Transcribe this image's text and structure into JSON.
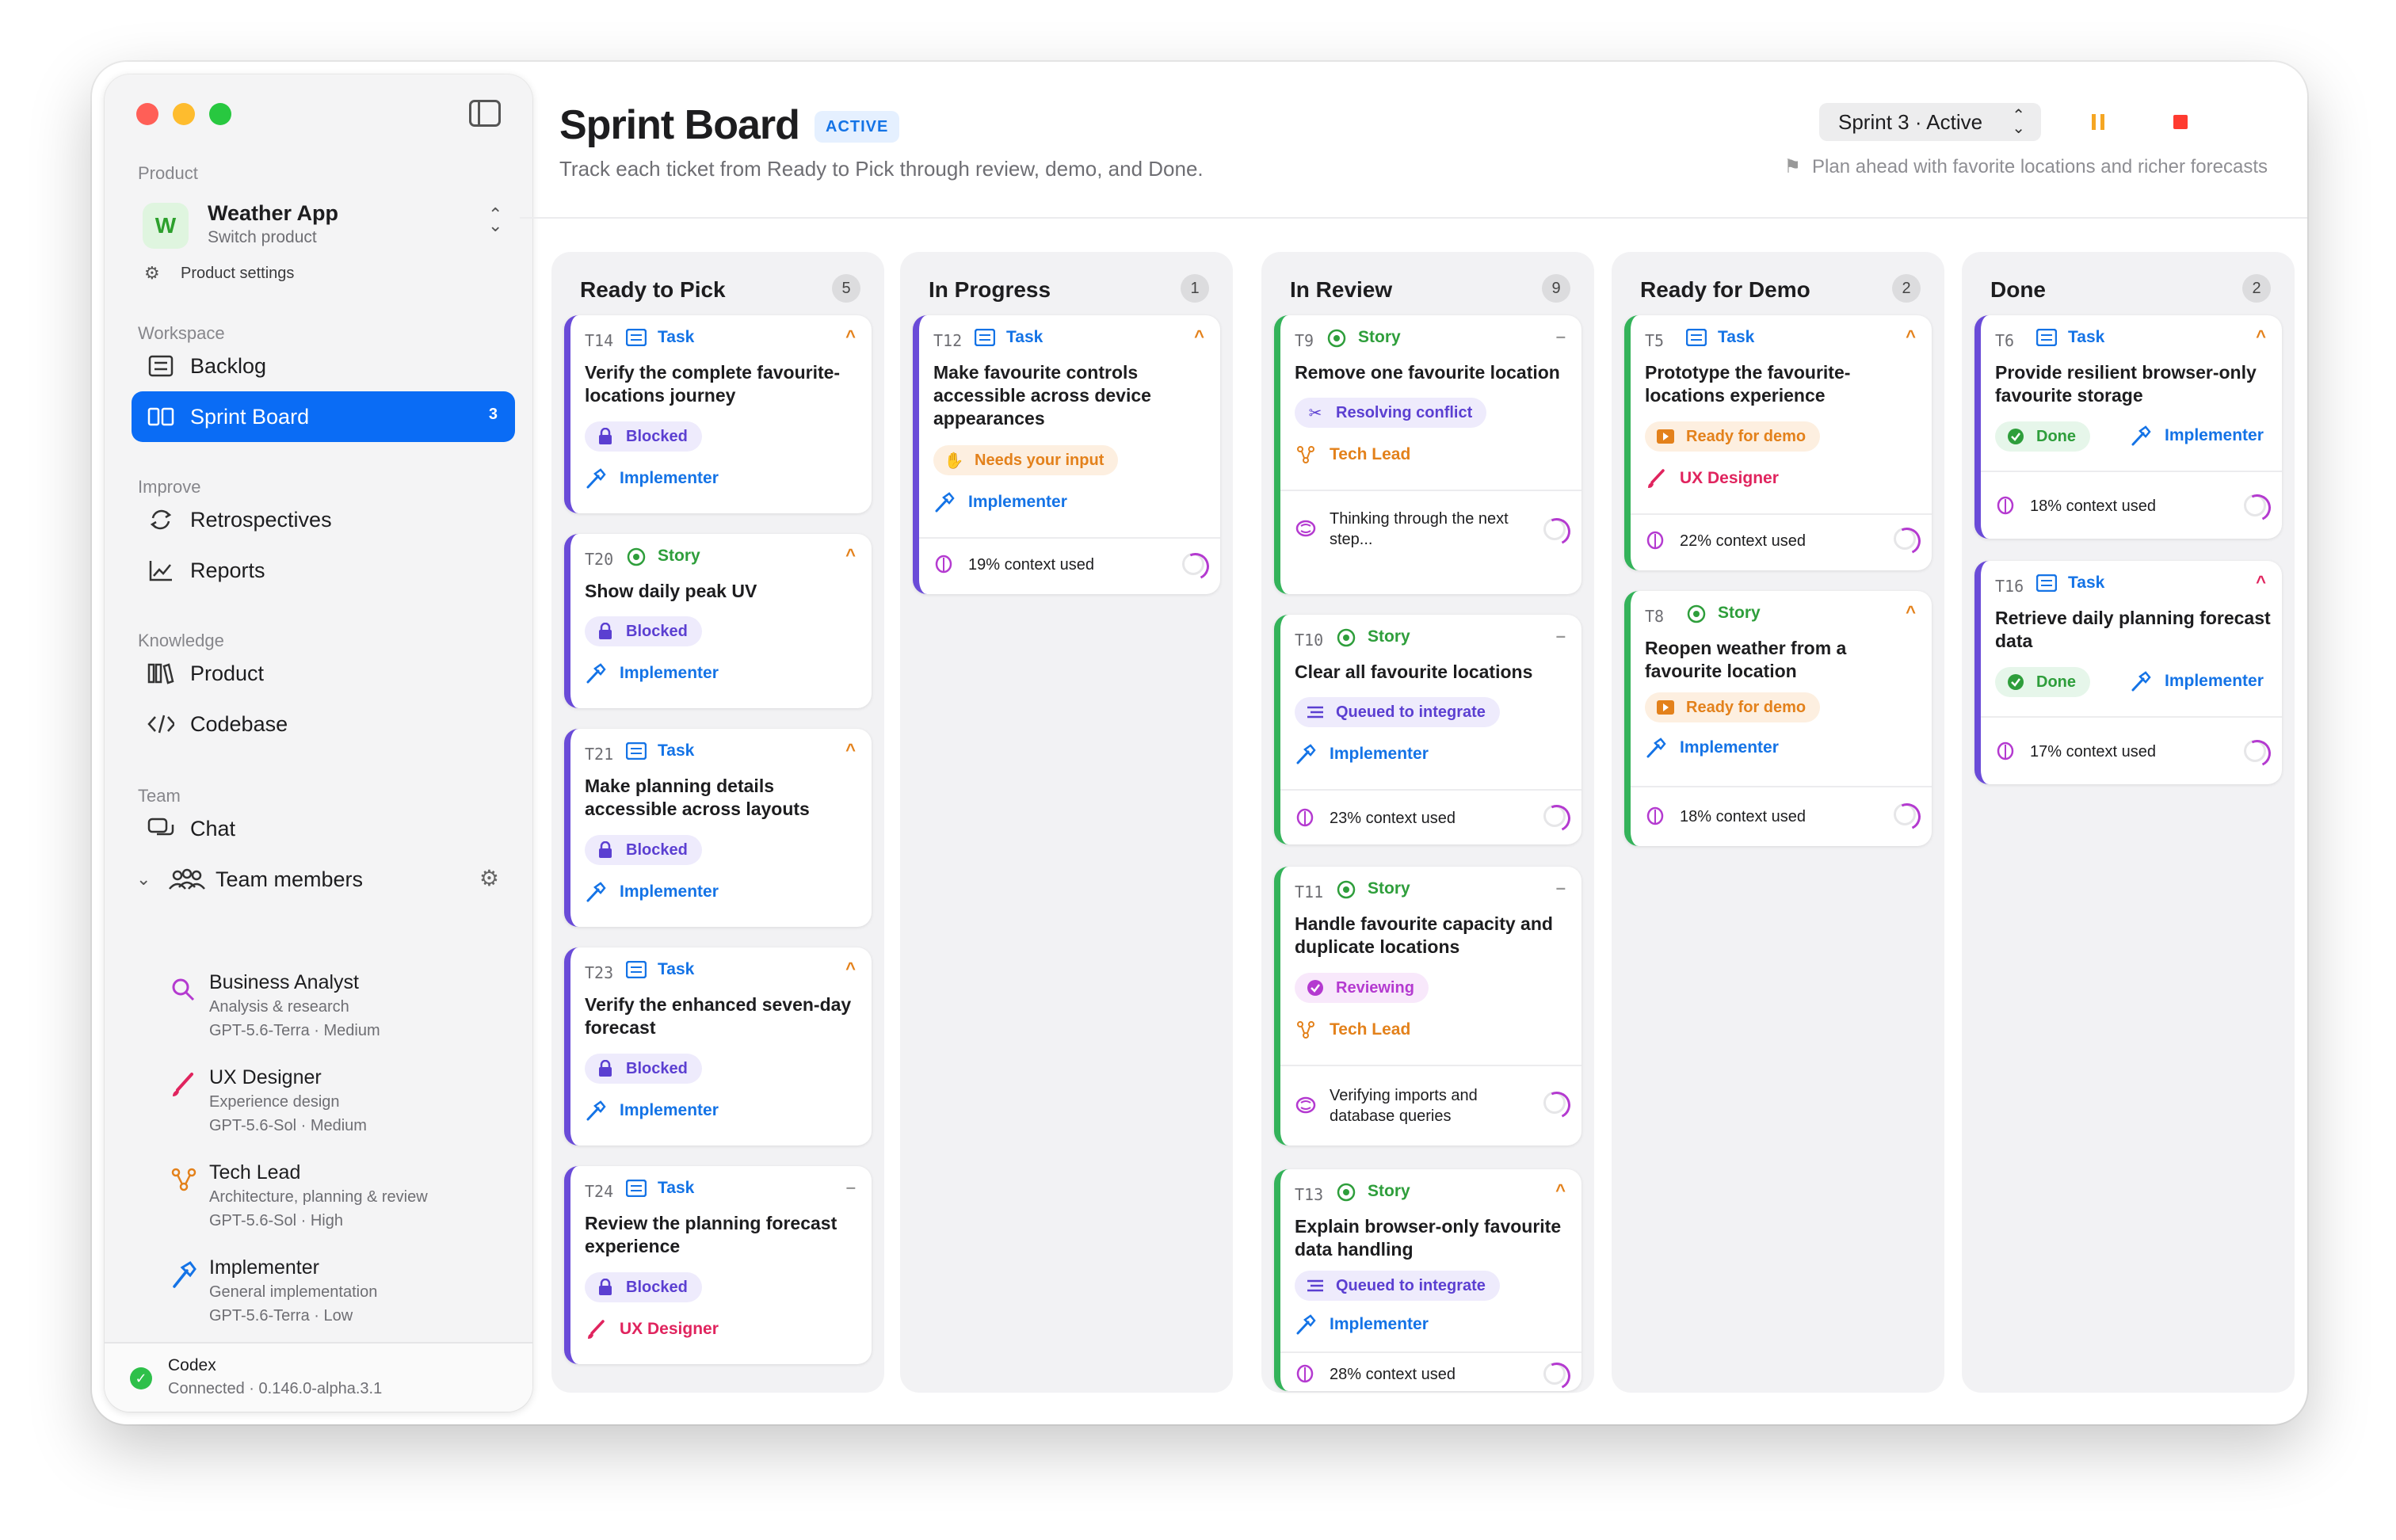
{
  "sidebar": {
    "product_section": "Product",
    "product_initial": "W",
    "product_name": "Weather App",
    "product_switch": "Switch product",
    "product_settings": "Product settings",
    "workspace_section": "Workspace",
    "backlog": "Backlog",
    "sprint_board": "Sprint Board",
    "sprint_board_badge": "3",
    "improve_section": "Improve",
    "retrospectives": "Retrospectives",
    "reports": "Reports",
    "knowledge_section": "Knowledge",
    "product": "Product",
    "codebase": "Codebase",
    "team_section": "Team",
    "chat": "Chat",
    "team_members": "Team members",
    "members": [
      {
        "name": "Business Analyst",
        "desc": "Analysis & research",
        "model": "GPT-5.6-Terra · Medium"
      },
      {
        "name": "UX Designer",
        "desc": "Experience design",
        "model": "GPT-5.6-Sol · Medium"
      },
      {
        "name": "Tech Lead",
        "desc": "Architecture, planning & review",
        "model": "GPT-5.6-Sol · High"
      },
      {
        "name": "Implementer",
        "desc": "General implementation",
        "model": "GPT-5.6-Terra · Low"
      }
    ],
    "footer_title": "Codex",
    "footer_status": "Connected · 0.146.0-alpha.3.1"
  },
  "header": {
    "title": "Sprint Board",
    "status_pill": "ACTIVE",
    "subtitle": "Track each ticket from Ready to Pick through review, demo, and Done.",
    "sprint_select": "Sprint 3 · Active",
    "sprint_goal": "Plan ahead with favorite locations and richer forecasts"
  },
  "colors": {
    "accent": "#0a6cf5",
    "pause": "#f5a623",
    "stop": "#ff3b30"
  },
  "columns": [
    {
      "title": "Ready to Pick",
      "count": "5"
    },
    {
      "title": "In Progress",
      "count": "1"
    },
    {
      "title": "In Review",
      "count": "9"
    },
    {
      "title": "Ready for Demo",
      "count": "2"
    },
    {
      "title": "Done",
      "count": "2"
    }
  ],
  "cards": {
    "t14": {
      "id": "T14",
      "kind": "Task",
      "pri": "^",
      "title": "Verify the complete favourite-locations journey",
      "tag": "Blocked",
      "role": "Implementer"
    },
    "t20": {
      "id": "T20",
      "kind": "Story",
      "pri": "^",
      "title": "Show daily peak UV",
      "tag": "Blocked",
      "role": "Implementer"
    },
    "t21": {
      "id": "T21",
      "kind": "Task",
      "pri": "^",
      "title": "Make planning details accessible across layouts",
      "tag": "Blocked",
      "role": "Implementer"
    },
    "t23": {
      "id": "T23",
      "kind": "Task",
      "pri": "^",
      "title": "Verify the enhanced seven-day forecast",
      "tag": "Blocked",
      "role": "Implementer"
    },
    "t24": {
      "id": "T24",
      "kind": "Task",
      "pri": "–",
      "title": "Review the planning forecast experience",
      "tag": "Blocked",
      "role": "UX Designer"
    },
    "t12": {
      "id": "T12",
      "kind": "Task",
      "pri": "^",
      "title": "Make favourite controls accessible across device appearances",
      "tag": "Needs your input",
      "role": "Implementer",
      "ctx": "19% context used"
    },
    "t9": {
      "id": "T9",
      "kind": "Story",
      "pri": "–",
      "title": "Remove one favourite location",
      "tag": "Resolving conflict",
      "role": "Tech Lead",
      "think": "Thinking through the next step..."
    },
    "t10": {
      "id": "T10",
      "kind": "Story",
      "pri": "–",
      "title": "Clear all favourite locations",
      "tag": "Queued to integrate",
      "role": "Implementer",
      "ctx": "23% context used"
    },
    "t11": {
      "id": "T11",
      "kind": "Story",
      "pri": "–",
      "title": "Handle favourite capacity and duplicate locations",
      "tag": "Reviewing",
      "role": "Tech Lead",
      "think": "Verifying imports and database queries"
    },
    "t13": {
      "id": "T13",
      "kind": "Story",
      "pri": "^",
      "title": "Explain browser-only favourite data handling",
      "tag": "Queued to integrate",
      "role": "Implementer",
      "ctx": "28% context used"
    },
    "t5": {
      "id": "T5",
      "kind": "Task",
      "pri": "^",
      "title": "Prototype the favourite-locations experience",
      "tag": "Ready for demo",
      "role": "UX Designer",
      "ctx": "22% context used"
    },
    "t8": {
      "id": "T8",
      "kind": "Story",
      "pri": "^",
      "title": "Reopen weather from a favourite location",
      "tag": "Ready for demo",
      "role": "Implementer",
      "ctx": "18% context used"
    },
    "t6": {
      "id": "T6",
      "kind": "Task",
      "pri": "^",
      "title": "Provide resilient browser-only favourite storage",
      "tag": "Done",
      "role": "Implementer",
      "ctx": "18% context used"
    },
    "t16": {
      "id": "T16",
      "kind": "Task",
      "pri": "^",
      "title": "Retrieve daily planning forecast data",
      "tag": "Done",
      "role": "Implementer",
      "ctx": "17% context used"
    }
  }
}
